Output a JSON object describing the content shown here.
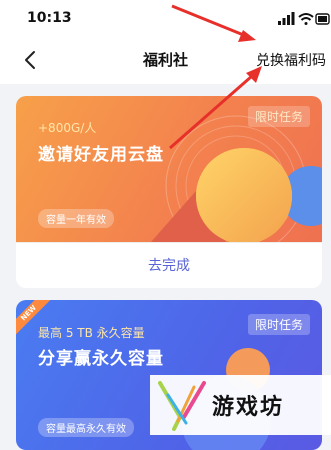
{
  "status_bar": {
    "time": "10:13"
  },
  "nav": {
    "title": "福利社",
    "redeem_link": "兑换福利码"
  },
  "cards": [
    {
      "reward": "+800G/人",
      "title": "邀请好友用云盘",
      "tag": "限时任务",
      "capacity": "容量一年有效",
      "action": "去完成"
    },
    {
      "ribbon": "NEW",
      "reward": "最高 5 TB 永久容量",
      "title": "分享赢永久容量",
      "tag": "限时任务",
      "capacity": "容量最高永久有效"
    }
  ],
  "watermark": {
    "text": "游戏坊"
  },
  "colors": {
    "accent": "#5a63d6",
    "orange_banner": "#f3814e",
    "blue_banner": "#4f64e8",
    "arrow": "#e8302a"
  }
}
